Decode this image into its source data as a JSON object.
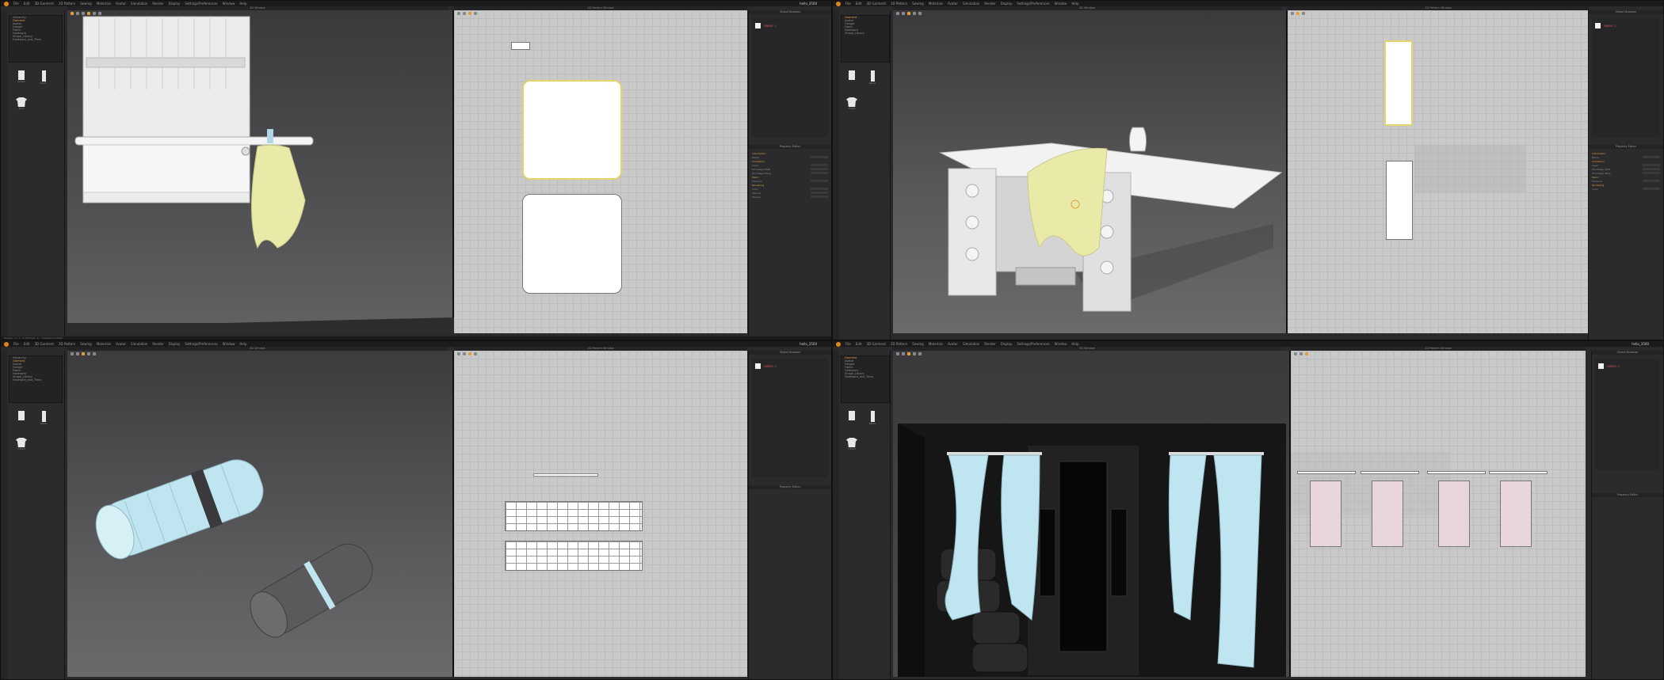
{
  "app": {
    "menu": [
      "File",
      "Edit",
      "3D Garment",
      "2D Pattern",
      "Sewing",
      "Materials",
      "Avatar",
      "Simulation",
      "Render",
      "Display",
      "Settings/Preferences",
      "Window",
      "Help"
    ],
    "user": "hello_3500"
  },
  "windows": {
    "viewport_3d": "3D Window",
    "viewport_2d": "2D Pattern Window",
    "object_browser": "Object Browser",
    "property_editor": "Property Editor"
  },
  "library": {
    "title": "Hierarchy",
    "items": [
      "Garment",
      "Avatar",
      "Hanger",
      "Fabric",
      "Hardware",
      "Shape_Library",
      "Hardware_and_Trims"
    ]
  },
  "thumbnails": [
    "Avatar",
    "Pants",
    "Shirt",
    "T-Shirt"
  ],
  "panes": [
    {
      "object": "FABRIC 1",
      "status": "Display - 1 / 1 / 0 (Triangle: 1) - Transparent Mesh"
    },
    {
      "object": "FABRIC 1",
      "status": ""
    },
    {
      "object": "FABRIC 1",
      "status": ""
    },
    {
      "object": "FABRIC 1",
      "status": ""
    }
  ],
  "properties": [
    "Information",
    "Name",
    "Simulation",
    "Layer",
    "Shrinkage Weft",
    "Shrinkage Warp",
    "Fabric",
    "Pressure",
    "Rendering",
    "Color",
    "Opacity",
    "Texture"
  ],
  "colors": {
    "accent": "#e0a040",
    "towel": "#eaeaa8",
    "blue_fabric": "#bfe6f0",
    "pink_pattern": "#e8d6da",
    "dark_fabric": "#5a5a5c"
  },
  "icons": [
    "clo-logo-icon",
    "select-icon",
    "move-icon",
    "rotate-icon",
    "zoom-icon",
    "fit-icon"
  ]
}
